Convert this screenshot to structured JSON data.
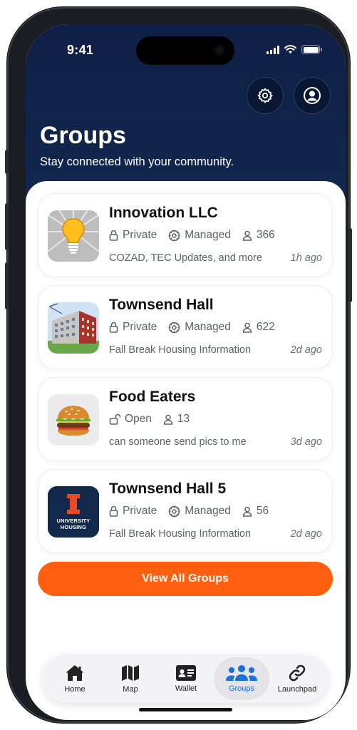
{
  "status_bar": {
    "time": "9:41"
  },
  "header": {
    "title": "Groups",
    "subtitle": "Stay connected with your community.",
    "settings_icon": "gear-icon",
    "profile_icon": "person-circle-icon"
  },
  "groups": [
    {
      "name": "Innovation LLC",
      "thumb": "lightbulb",
      "privacy": "Private",
      "privacy_icon": "lock-icon",
      "managed": "Managed",
      "members": "366",
      "preview": "COZAD, TEC Updates, and more",
      "time": "1h ago"
    },
    {
      "name": "Townsend Hall",
      "thumb": "building-photo",
      "privacy": "Private",
      "privacy_icon": "lock-icon",
      "managed": "Managed",
      "members": "622",
      "preview": "Fall Break Housing Information",
      "time": "2d ago"
    },
    {
      "name": "Food Eaters",
      "thumb": "burger",
      "privacy": "Open",
      "privacy_icon": "unlock-icon",
      "managed": "",
      "members": "13",
      "preview": "can someone send pics to me",
      "time": "3d ago"
    },
    {
      "name": "Townsend Hall 5",
      "thumb": "university-housing-logo",
      "privacy": "Private",
      "privacy_icon": "lock-icon",
      "managed": "Managed",
      "members": "56",
      "preview": "Fall Break Housing Information",
      "time": "2d ago"
    }
  ],
  "logo_text": {
    "letter": "I",
    "line1": "UNIVERSITY",
    "line2": "HOUSING"
  },
  "cta_label": "View All Groups",
  "tabs": [
    {
      "label": "Home",
      "icon": "house-icon"
    },
    {
      "label": "Map",
      "icon": "map-icon"
    },
    {
      "label": "Wallet",
      "icon": "id-card-icon"
    },
    {
      "label": "Groups",
      "icon": "people-icon",
      "active": true
    },
    {
      "label": "Launchpad",
      "icon": "link-icon"
    }
  ],
  "colors": {
    "header": "#0f1f45",
    "accent": "#ff5f0f",
    "active_tab": "#1c6fd6",
    "logo_bg": "#13294b",
    "logo_orange": "#e84a27"
  }
}
